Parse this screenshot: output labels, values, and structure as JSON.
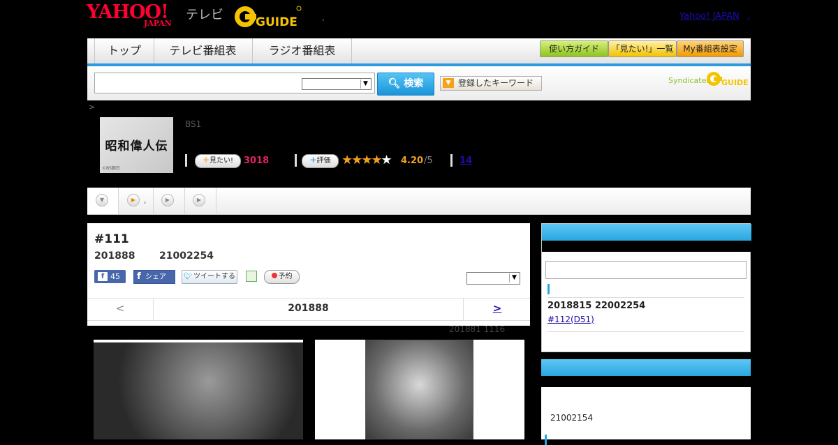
{
  "header": {
    "logo_yahoo": "YAHOO!",
    "logo_japan": "JAPAN",
    "logo_tv": "テレビ",
    "gguide": "GUIDE",
    "yahoo_link": "Yahoo! JAPAN",
    "yahoo_link_suffix": ",",
    "dot": ","
  },
  "nav": {
    "tabs": [
      "トップ",
      "テレビ番組表",
      "ラジオ番組表"
    ],
    "guide_button": "使い方ガイド",
    "wanted_list_button": "「見たい!」一覧",
    "my_schedule_button": "My番組表設定"
  },
  "search": {
    "input_value": "",
    "select_value": "",
    "button_label": "検索",
    "keywords_button": "登録したキーワード",
    "syndicated": "Syndicated",
    "gguide": "GUIDE"
  },
  "program": {
    "breadcrumb": ">",
    "thumbnail_title": "昭和偉人伝",
    "thumbnail_credit": "©BS朝日",
    "channel": "BS1",
    "wanted_button": "見たい!",
    "wanted_count": "3018",
    "rate_button": "評価",
    "stars": "★★★★",
    "star_empty": "★",
    "rating": "4.20",
    "rating_max": "/5",
    "review_count": "14"
  },
  "tabs_row": {
    "comma": ","
  },
  "episode": {
    "title": "#111",
    "date": "201888",
    "time": "21002254",
    "fb_like_count": "45",
    "fb_share_label": "シェア",
    "tweet_label": "ツイートする",
    "reserve_label": "予約",
    "select_value": "",
    "prev": "<",
    "middle_date": "201888",
    "next": ">",
    "update_info": "201881  1116"
  },
  "sidebar": {
    "next_airing": "2018815  22002254",
    "next_link": "#112(D51)",
    "bottom_text": "21002154"
  }
}
